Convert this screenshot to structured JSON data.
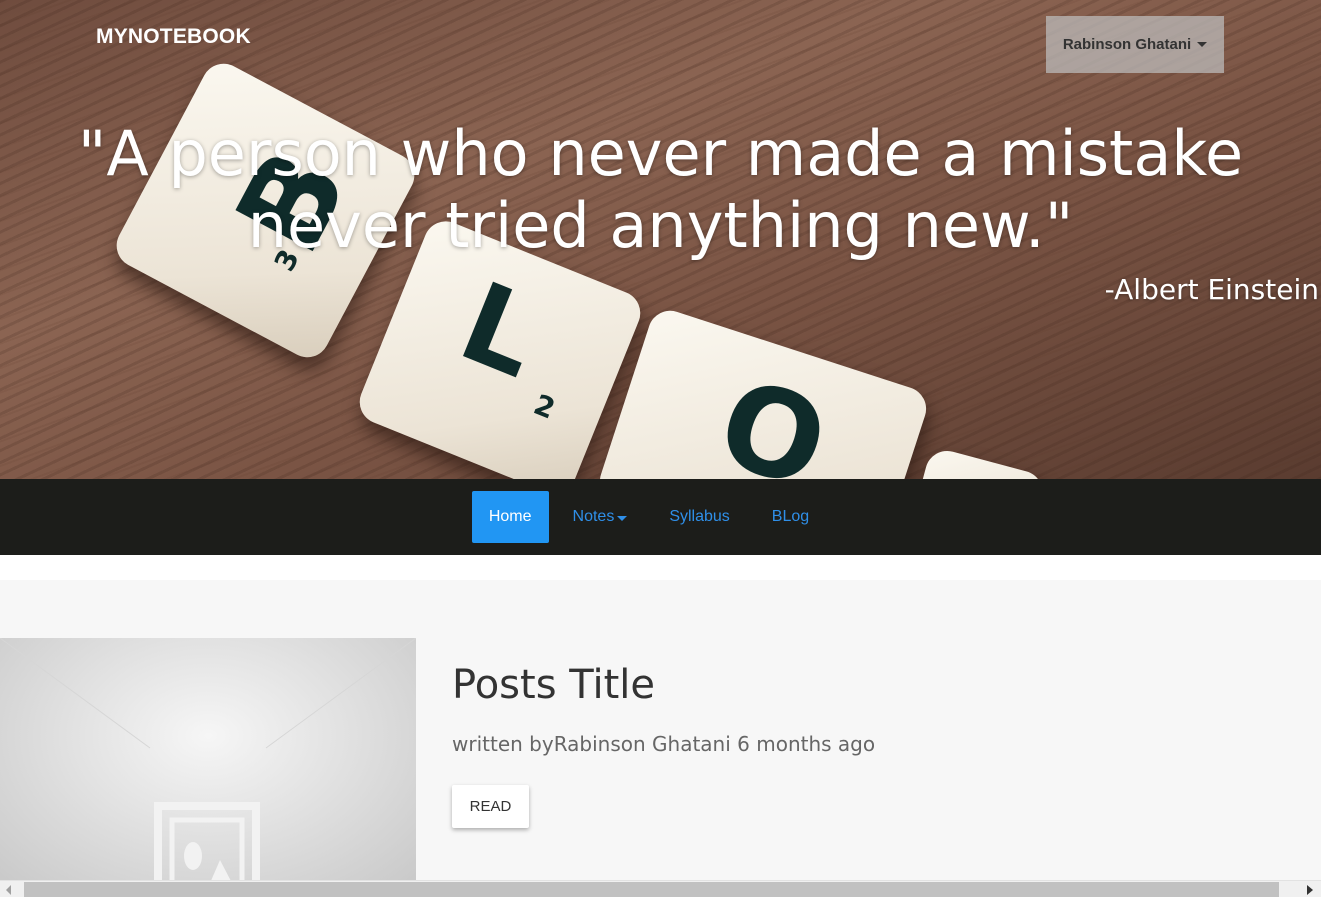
{
  "header": {
    "brand": "MYNOTEBOOK",
    "user_menu": {
      "label": "Rabinson Ghatani",
      "icon": "caret-down-icon"
    }
  },
  "hero": {
    "quote": "\"A person who never made a mistake never tried anything new.\"",
    "author": "-Albert Einstein",
    "tiles": {
      "b": "B",
      "b_num": "3",
      "l": "L",
      "l_num": "2",
      "o": "O"
    }
  },
  "nav": {
    "items": [
      {
        "label": "Home",
        "active": true
      },
      {
        "label": "Notes",
        "active": false,
        "icon": "caret-down-icon"
      },
      {
        "label": "Syllabus",
        "active": false
      },
      {
        "label": "BLog",
        "active": false
      }
    ]
  },
  "post": {
    "title": "Posts Title",
    "meta": "written byRabinson Ghatani 6 months ago",
    "read_label": "READ",
    "image_icon": "image-placeholder-icon"
  },
  "colors": {
    "nav_bg": "#1c1d1a",
    "active_tab": "#2196f3",
    "link": "#2f8fe8",
    "content_bg": "#f7f7f7"
  }
}
